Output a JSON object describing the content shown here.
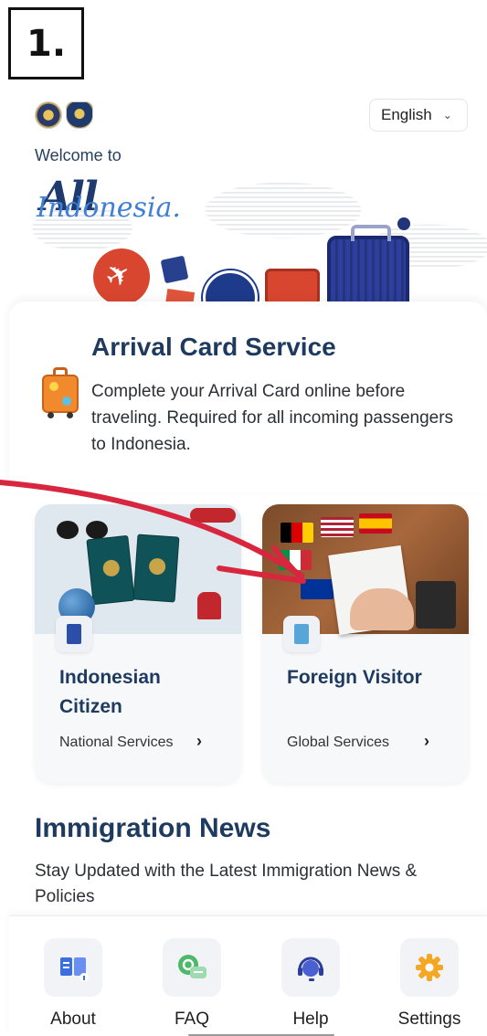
{
  "annotation": {
    "step_label": "1."
  },
  "header": {
    "language": "English",
    "welcome": "Welcome to",
    "brand_main": "All",
    "brand_script": "Indonesia."
  },
  "arrival": {
    "title": "Arrival Card Service",
    "description": "Complete your Arrival Card online before traveling. Required for all incoming passengers to Indonesia."
  },
  "services": [
    {
      "title": "Indonesian Citizen",
      "link": "National Services"
    },
    {
      "title": "Foreign Visitor",
      "link": "Global Services"
    }
  ],
  "news": {
    "title": "Immigration News",
    "description": "Stay Updated with the Latest Immigration News & Policies"
  },
  "bottom_nav": [
    {
      "label": "About",
      "icon": "book-icon"
    },
    {
      "label": "FAQ",
      "icon": "chat-icon"
    },
    {
      "label": "Help",
      "icon": "headset-icon"
    },
    {
      "label": "Settings",
      "icon": "gear-icon"
    }
  ],
  "colors": {
    "primary_text": "#1e3a5f",
    "annotation_arrow": "#d7263d",
    "settings_icon": "#f5a623",
    "about_icon": "#3b6fe0"
  }
}
